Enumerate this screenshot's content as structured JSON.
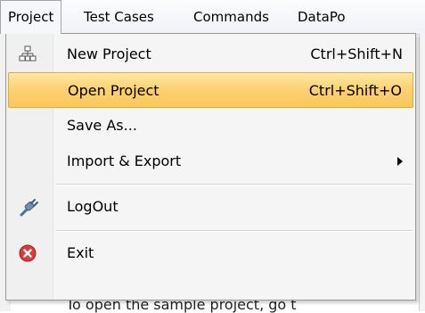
{
  "menubar": {
    "items": [
      {
        "label": "Project"
      },
      {
        "label": "Test Cases"
      },
      {
        "label": "Commands"
      },
      {
        "label": "DataPo"
      }
    ]
  },
  "dropdown": {
    "items": [
      {
        "label": "New Project",
        "shortcut": "Ctrl+Shift+N",
        "icon": "new-project-icon"
      },
      {
        "label": "Open Project",
        "shortcut": "Ctrl+Shift+O",
        "highlighted": true
      },
      {
        "label": "Save As..."
      },
      {
        "label": "Import & Export",
        "submenu": true
      },
      {
        "label": "LogOut",
        "icon": "logout-icon"
      },
      {
        "label": "Exit",
        "icon": "exit-icon"
      }
    ]
  },
  "background": {
    "text": "To open the sample project, go t"
  },
  "colors": {
    "highlight_top": "#fde9a7",
    "highlight_bottom": "#fbc75a",
    "highlight_border": "#e5a93a",
    "exit_icon": "#e23a3a"
  }
}
